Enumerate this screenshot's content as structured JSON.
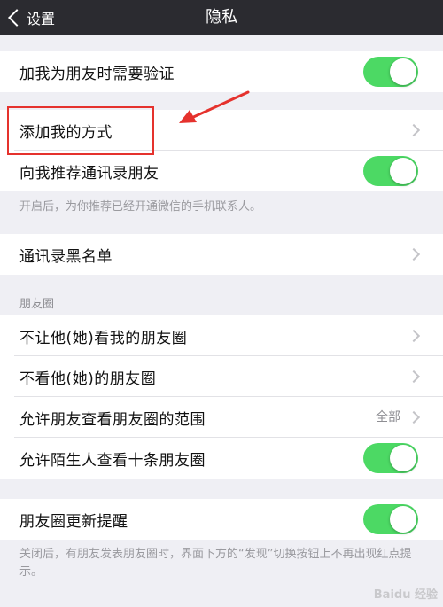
{
  "navbar": {
    "back_label": "设置",
    "title": "隐私"
  },
  "group1": {
    "verify_label": "加我为朋友时需要验证",
    "verify_on": true
  },
  "group2": {
    "add_methods_label": "添加我的方式",
    "recommend_contacts_label": "向我推荐通讯录朋友",
    "recommend_on": true
  },
  "note1": "开启后，为你推荐已经开通微信的手机联系人。",
  "group3": {
    "blacklist_label": "通讯录黑名单"
  },
  "moments_header": "朋友圈",
  "group4": {
    "items": [
      {
        "label": "不让他(她)看我的朋友圈"
      },
      {
        "label": "不看他(她)的朋友圈"
      },
      {
        "label": "允许朋友查看朋友圈的范围",
        "value": "全部"
      },
      {
        "label": "允许陌生人查看十条朋友圈",
        "toggle_on": true
      }
    ]
  },
  "group5": {
    "update_reminder_label": "朋友圈更新提醒",
    "reminder_on": true
  },
  "note2": "关闭后，有朋友发表朋友圈时，界面下方的“发现”切换按钮上不再出现红点提示。",
  "watermark": "Baidu 经验",
  "colors": {
    "accent_green": "#4cd964",
    "highlight_red": "#e5322d",
    "navbar_bg": "#2b2b30"
  }
}
